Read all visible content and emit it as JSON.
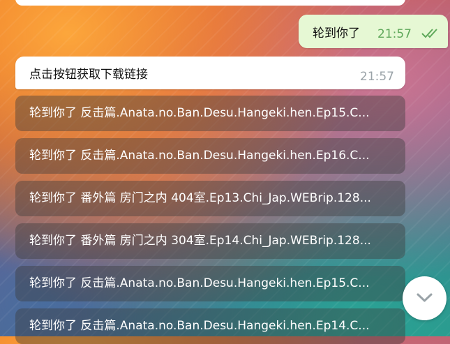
{
  "outgoing": {
    "text": "轮到你了",
    "time": "21:57",
    "status_icon": "double-check-icon"
  },
  "incoming": {
    "text": "点击按钮获取下载链接",
    "time": "21:57"
  },
  "buttons": [
    "轮到你了 反击篇.Anata.no.Ban.Desu.Hangeki.hen.Ep15.C...",
    "轮到你了 反击篇.Anata.no.Ban.Desu.Hangeki.hen.Ep16.C...",
    "轮到你了 番外篇 房门之内 404室.Ep13.Chi_Jap.WEBrip.128...",
    "轮到你了 番外篇 房门之内 304室.Ep14.Chi_Jap.WEBrip.128...",
    "轮到你了 反击篇.Anata.no.Ban.Desu.Hangeki.hen.Ep15.C...",
    "轮到你了 反击篇.Anata.no.Ban.Desu.Hangeki.hen.Ep14.C..."
  ],
  "scroll_button": {
    "icon": "chevron-down-icon"
  },
  "colors": {
    "outgoing_bg": "#e6f8d4",
    "time_green": "#5fa85a",
    "incoming_bg": "#ffffff"
  }
}
